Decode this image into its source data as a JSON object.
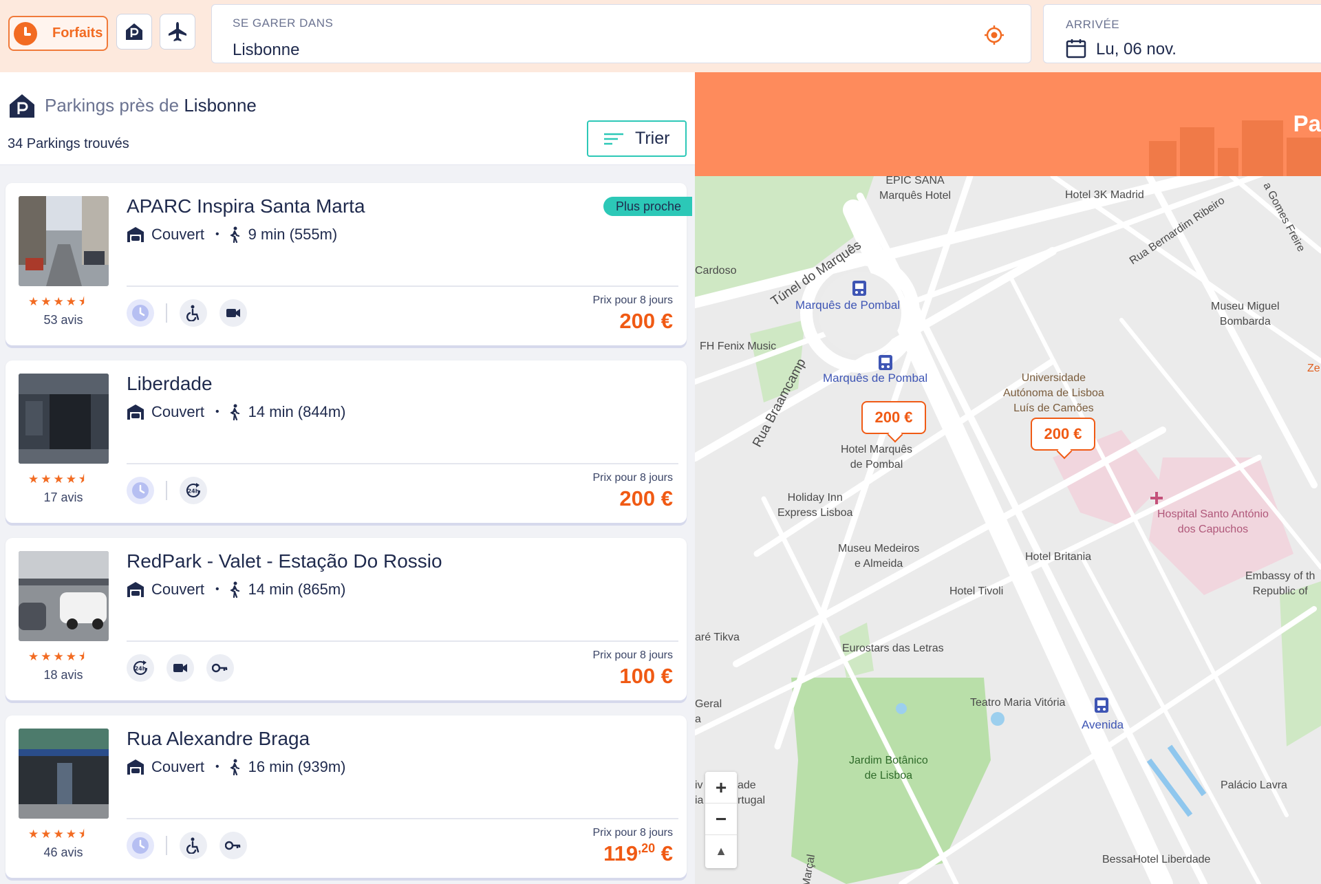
{
  "topbar": {
    "forfaits_label": "Forfaits",
    "search_caption": "SE GARER DANS",
    "search_value": "Lisbonne",
    "arrival_caption": "ARRIVÉE",
    "arrival_value": "Lu, 06 nov."
  },
  "list": {
    "title_prefix": "Parkings près de",
    "title_city": "Lisbonne",
    "count": "34 Parkings trouvés",
    "sort_label": "Trier"
  },
  "parkings": [
    {
      "name": "APARC Inspira Santa Marta",
      "type": "Couvert",
      "walk": "9 min (555m)",
      "reviews": "53 avis",
      "rating": 4.5,
      "price_caption": "Prix pour 8 jours",
      "price": "200 €",
      "badge": "Plus proche",
      "features": [
        "clock-icon",
        "wheelchair-icon",
        "camera-icon"
      ]
    },
    {
      "name": "Liberdade",
      "type": "Couvert",
      "walk": "14 min (844m)",
      "reviews": "17 avis",
      "rating": 4.5,
      "price_caption": "Prix pour 8 jours",
      "price": "200 €",
      "features": [
        "clock-icon",
        "24h-icon"
      ]
    },
    {
      "name": "RedPark - Valet - Estação Do Rossio",
      "type": "Couvert",
      "walk": "14 min (865m)",
      "reviews": "18 avis",
      "rating": 4.5,
      "price_caption": "Prix pour 8 jours",
      "price": "100 €",
      "features": [
        "24h-icon",
        "camera-icon",
        "key-icon"
      ]
    },
    {
      "name": "Rua Alexandre Braga",
      "type": "Couvert",
      "walk": "16 min (939m)",
      "reviews": "46 avis",
      "rating": 4.5,
      "price_caption": "Prix pour 8 jours",
      "price_main": "119",
      "price_cents": ",20",
      "price_currency": " €",
      "features": [
        "clock-icon",
        "wheelchair-icon",
        "key-icon"
      ]
    }
  ],
  "map": {
    "promo_text": "Pa",
    "pins": [
      "200 €",
      "200 €"
    ],
    "labels": {
      "epic": "EPIC SANA\nMarquês Hotel",
      "hotel3k": "Hotel 3K Madrid",
      "cardoso": "Cardoso",
      "tunel": "Túnel do Marquês",
      "marques1": "Marquês de Pombal",
      "fenix": "FH Fenix Music",
      "marques2": "Marquês de Pombal",
      "univ": "Universidade\nAutónoma de Lisboa\nLuís de Camões",
      "museu_miguel": "Museu Miguel\nBombarda",
      "bernardim": "Rua Bernardim Ribeiro",
      "gomes": "a Gomes Freire",
      "braamcamp": "Rua Braamcamp",
      "hotel_marques": "Hotel Marquês\nde Pombal",
      "holiday": "Holiday Inn\nExpress Lisboa",
      "hospital": "Hospital Santo António\ndos Capuchos",
      "medeiros": "Museu Medeiros\ne Almeida",
      "britania": "Hotel Britania",
      "tivoli": "Hotel Tivoli",
      "embassy": "Embassy of th\nRepublic of",
      "tikva": "aré Tikva",
      "eurostars": "Eurostars das Letras",
      "teatro": "Teatro Maria Vitória",
      "avenida": "Avenida",
      "geral": "Geral\na",
      "jardim": "Jardim Botânico\nde Lisboa",
      "iv": "iv\nia",
      "ade": "ade\nrtugal",
      "lavra": "Palácio Lavra",
      "bessa": "BessaHotel Liberdade",
      "ze": "Ze",
      "marcal": "Marçal"
    },
    "zoom_in": "+",
    "zoom_out": "−",
    "compass": "▲"
  },
  "colors": {
    "accent": "#f26b22",
    "teal": "#2cc8b7",
    "navy": "#1f2a4d",
    "price": "#f05a14"
  }
}
